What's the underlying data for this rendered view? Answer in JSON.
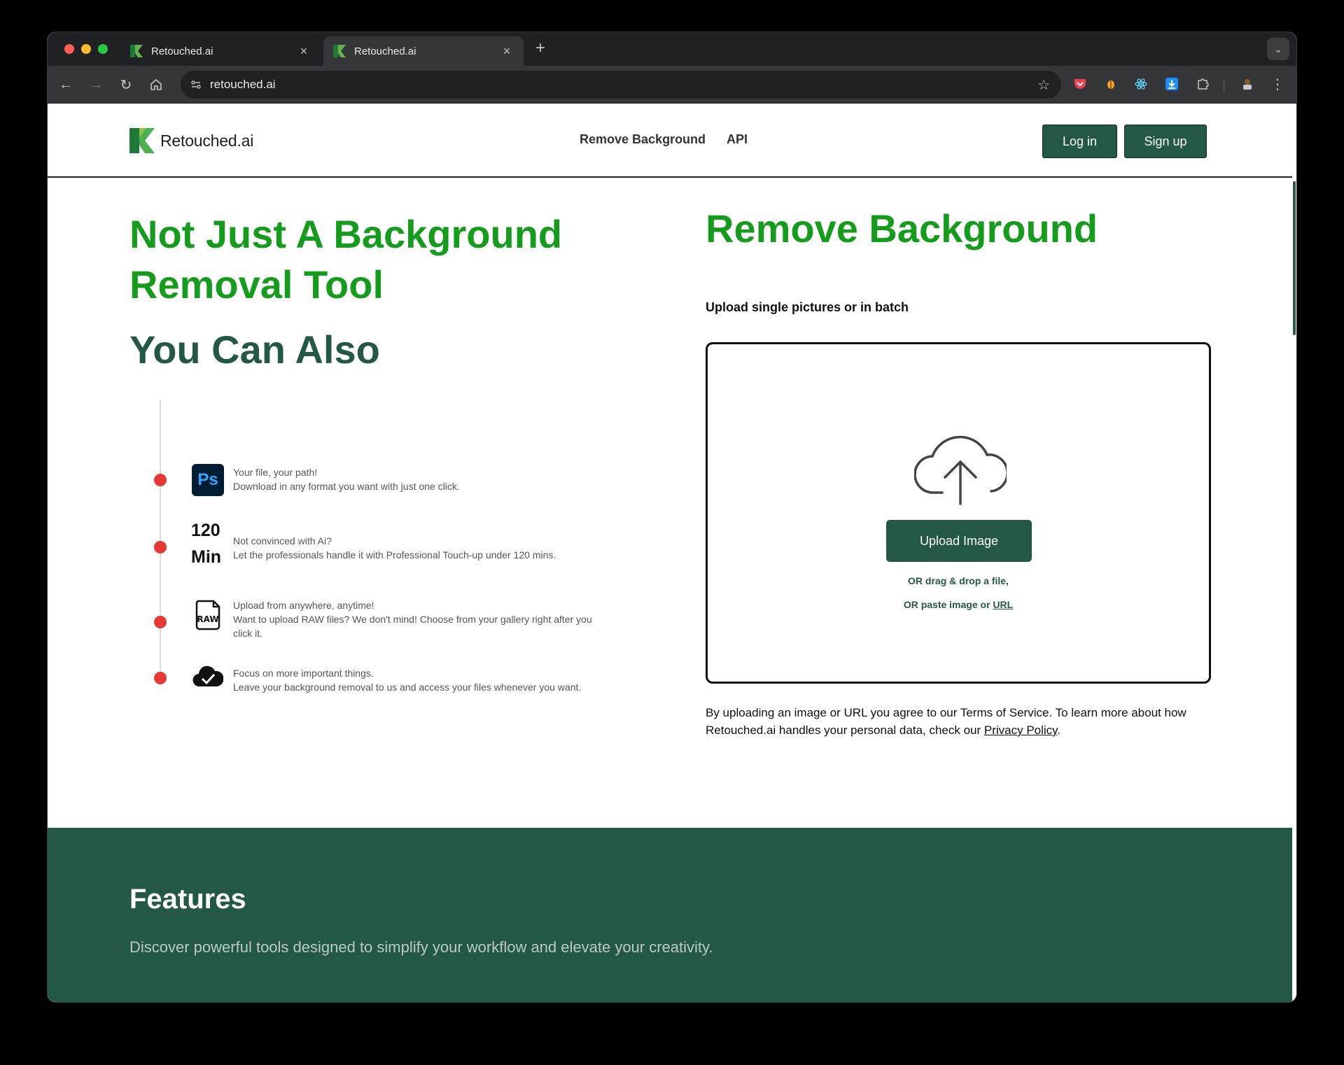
{
  "browser": {
    "tabs": [
      {
        "title": "Retouched.ai",
        "close": "×"
      },
      {
        "title": "Retouched.ai",
        "close": "×"
      }
    ],
    "new_tab": "+",
    "url": "retouched.ai"
  },
  "site": {
    "logo_text": "Retouched.ai",
    "nav": [
      "Remove Background",
      "API"
    ],
    "login_label": "Log in",
    "signup_label": "Sign up"
  },
  "hero": {
    "title": "Not Just A Background Removal Tool",
    "also_title": "You Can Also",
    "features": [
      {
        "icon": "photoshop-icon",
        "icon_text": "Ps",
        "line1": "Your file, your path!",
        "line2": "Download in any format you want with just one click."
      },
      {
        "icon": "clock-badge",
        "badge_top": "120",
        "badge_bottom": "Min",
        "line1": "Not convinced with Ai?",
        "line2": "Let the professionals handle it with Professional Touch-up under 120 mins."
      },
      {
        "icon": "raw-file-icon",
        "icon_text": "RAW",
        "line1": "Upload from anywhere, anytime!",
        "line2": "Want to upload RAW files? We don't mind! Choose from your gallery right after you click it."
      },
      {
        "icon": "cloud-check-icon",
        "line1": "Focus on more important things.",
        "line2": "Leave your background removal to us and access your files whenever you want."
      }
    ]
  },
  "remove_bg": {
    "title": "Remove Background",
    "subtitle": "Upload single pictures or in batch",
    "upload_button": "Upload Image",
    "or_drag": "OR drag & drop a file,",
    "or_paste": "OR paste image or ",
    "url_link": "URL",
    "terms_before": "By uploading an image or URL you agree to our Terms of Service. To learn more about how Retouched.ai handles your personal data, check our ",
    "privacy_link": "Privacy Policy",
    "terms_after": "."
  },
  "features_section": {
    "title": "Features",
    "subtitle": "Discover powerful tools designed to simplify your workflow and elevate your creativity."
  },
  "colors": {
    "brand_green": "#169c1d",
    "dark_green": "#235846",
    "dot_red": "#e53935"
  }
}
